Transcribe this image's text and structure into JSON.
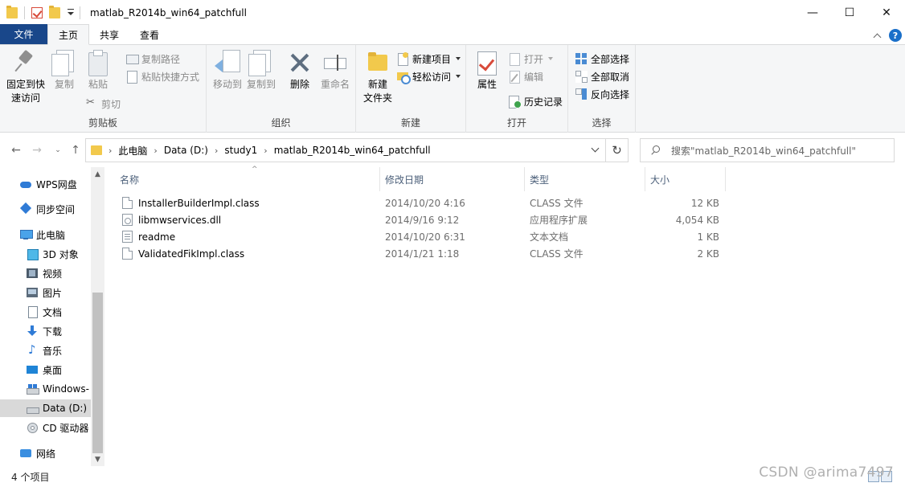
{
  "window": {
    "title": "matlab_R2014b_win64_patchfull",
    "minimize": "—",
    "maximize": "☐",
    "close": "✕"
  },
  "ribbon_tabs": [
    "文件",
    "主页",
    "共享",
    "查看"
  ],
  "ribbon": {
    "clipboard": {
      "label": "剪贴板",
      "pin": "固定到快\n速访问",
      "copy": "复制",
      "paste": "粘贴",
      "copy_path": "复制路径",
      "paste_shortcut": "粘贴快捷方式",
      "cut": "剪切"
    },
    "organize": {
      "label": "组织",
      "move_to": "移动到",
      "copy_to": "复制到",
      "delete": "删除",
      "rename": "重命名"
    },
    "new": {
      "label": "新建",
      "new_folder": "新建\n文件夹",
      "new_item": "新建项目",
      "easy_access": "轻松访问"
    },
    "open": {
      "label": "打开",
      "properties": "属性",
      "open": "打开",
      "edit": "编辑",
      "history": "历史记录"
    },
    "select": {
      "label": "选择",
      "select_all": "全部选择",
      "select_none": "全部取消",
      "invert": "反向选择"
    }
  },
  "address": {
    "crumbs": [
      "此电脑",
      "Data (D:)",
      "study1",
      "matlab_R2014b_win64_patchfull"
    ],
    "search_placeholder": "搜索\"matlab_R2014b_win64_patchfull\""
  },
  "nav_pane": {
    "items": [
      {
        "label": "WPS网盘",
        "icon": "cloud-icon"
      },
      {
        "label": "同步空间",
        "icon": "sync-icon"
      },
      {
        "label": "此电脑",
        "icon": "pc-icon"
      },
      {
        "label": "3D 对象",
        "icon": "3d-objects-icon"
      },
      {
        "label": "视频",
        "icon": "video-icon"
      },
      {
        "label": "图片",
        "icon": "pictures-icon"
      },
      {
        "label": "文档",
        "icon": "documents-icon"
      },
      {
        "label": "下载",
        "icon": "download-icon"
      },
      {
        "label": "音乐",
        "icon": "music-icon"
      },
      {
        "label": "桌面",
        "icon": "desktop-icon"
      },
      {
        "label": "Windows-",
        "icon": "windows-drive-icon"
      },
      {
        "label": "Data (D:)",
        "icon": "drive-icon"
      },
      {
        "label": "CD 驱动器",
        "icon": "cd-drive-icon"
      },
      {
        "label": "网络",
        "icon": "network-icon"
      }
    ]
  },
  "file_list": {
    "columns": [
      "名称",
      "修改日期",
      "类型",
      "大小"
    ],
    "rows": [
      {
        "name": "InstallerBuilderImpl.class",
        "date": "2014/10/20 4:16",
        "type": "CLASS 文件",
        "size": "12 KB"
      },
      {
        "name": "libmwservices.dll",
        "date": "2014/9/16 9:12",
        "type": "应用程序扩展",
        "size": "4,054 KB"
      },
      {
        "name": "readme",
        "date": "2014/10/20 6:31",
        "type": "文本文档",
        "size": "1 KB"
      },
      {
        "name": "ValidatedFikImpl.class",
        "date": "2014/1/21 1:18",
        "type": "CLASS 文件",
        "size": "2 KB"
      }
    ]
  },
  "status": {
    "count": "4 个项目"
  },
  "watermark": "CSDN @arima7497"
}
